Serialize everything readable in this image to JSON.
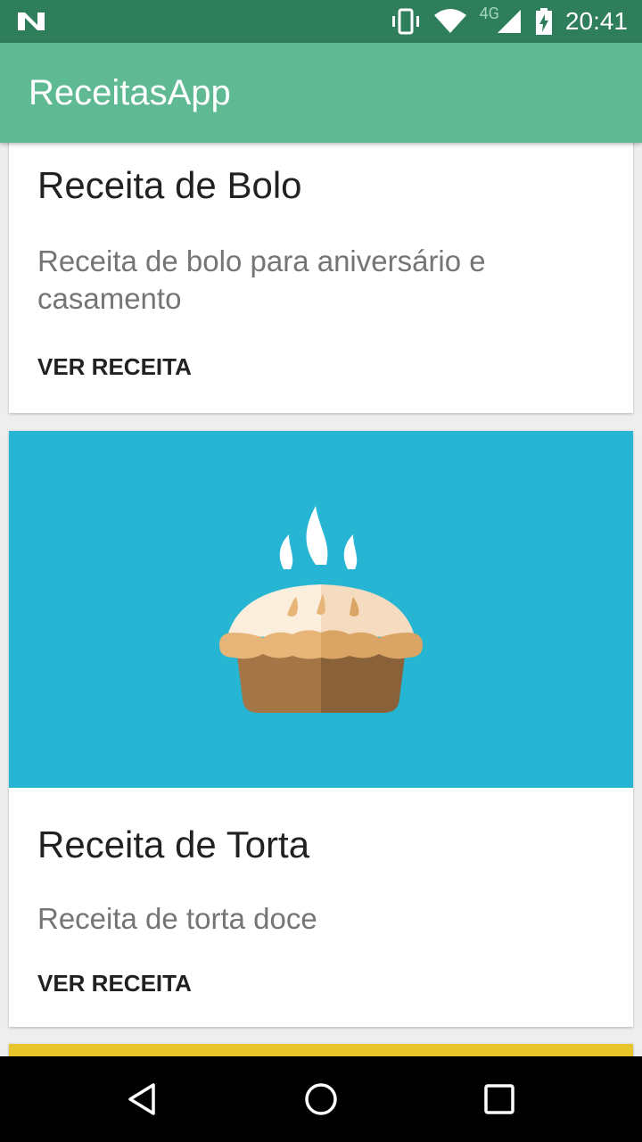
{
  "status_bar": {
    "time": "20:41",
    "network": "4G",
    "icons": [
      "notification-n-icon",
      "vibrate-icon",
      "wifi-icon",
      "signal-icon",
      "battery-charging-icon"
    ]
  },
  "app_bar": {
    "title": "ReceitasApp",
    "color": "#5fba94"
  },
  "cards": [
    {
      "title": "Receita de Bolo",
      "description": "Receita de bolo para aniversário e casamento",
      "action": "VER RECEITA"
    },
    {
      "title": "Receita de Torta",
      "description": "Receita de torta doce",
      "action": "VER RECEITA",
      "media_icon": "pie-icon",
      "media_color": "#26b5d3"
    },
    {
      "media_color": "#e8c52a"
    }
  ],
  "nav_bar": {
    "icons": [
      "back-icon",
      "home-icon",
      "recents-icon"
    ]
  }
}
